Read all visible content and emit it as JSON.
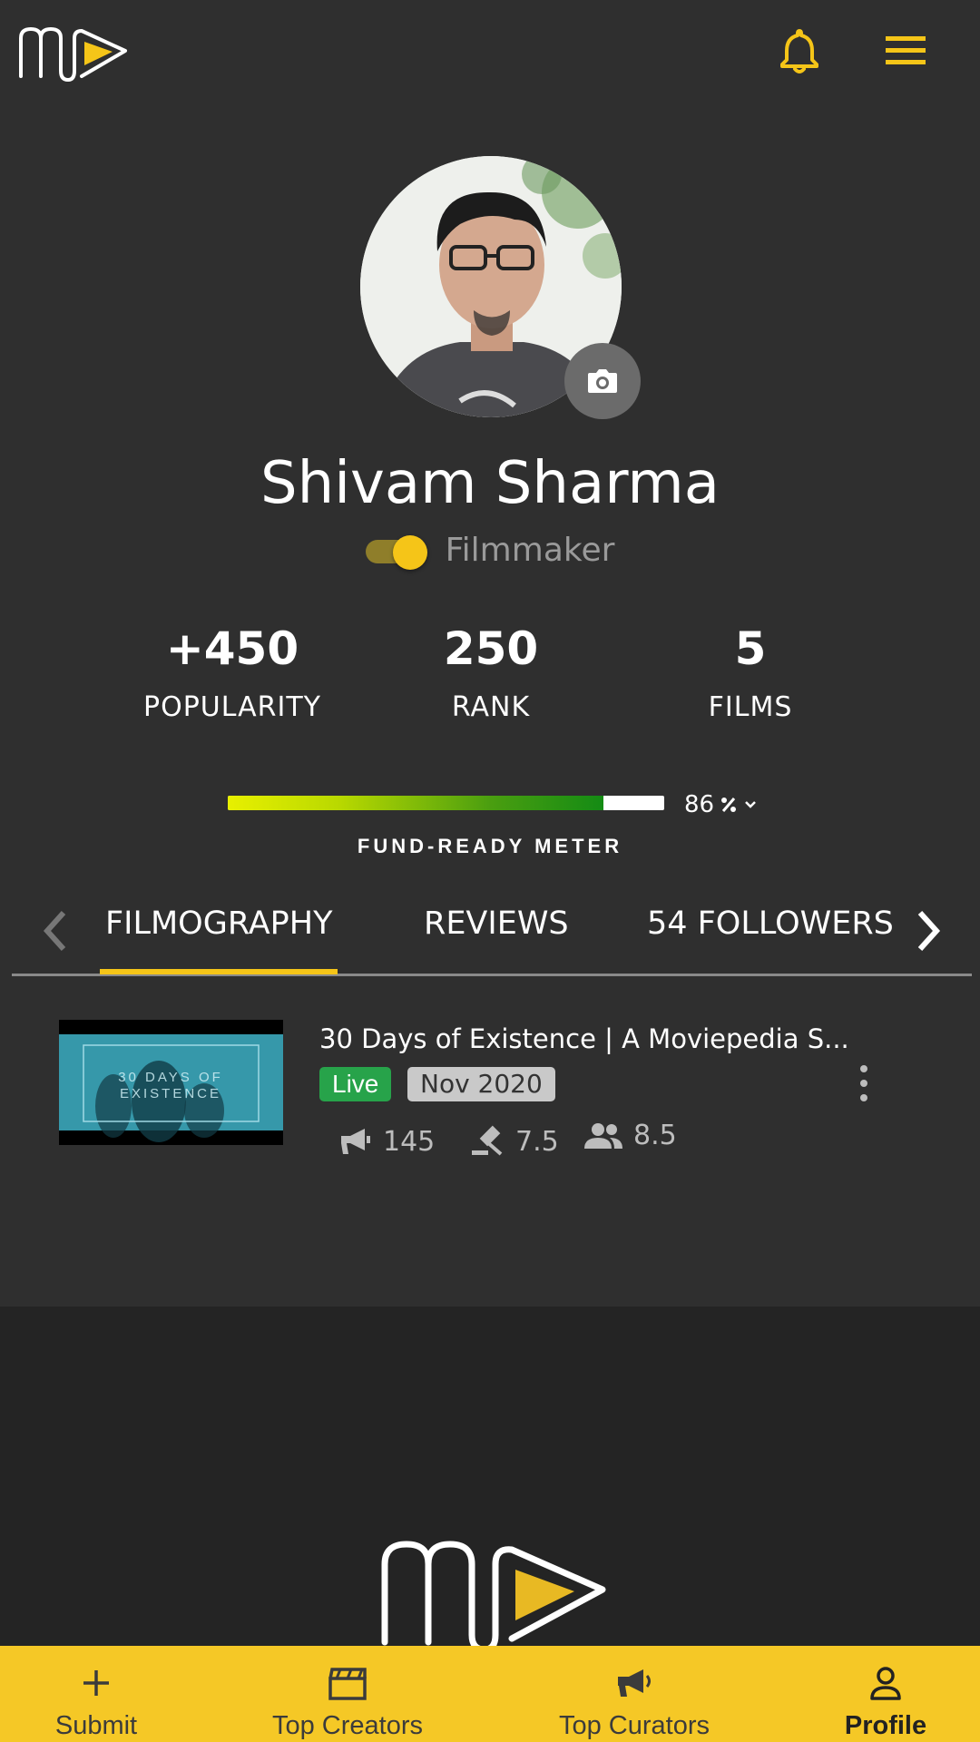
{
  "colors": {
    "accent": "#f5c518",
    "background": "#2f2f2f",
    "live": "#27a34a",
    "nav": "#f5c826"
  },
  "header": {
    "logo_icon": "moviepedia-logo",
    "notification_icon": "bell-icon",
    "menu_icon": "hamburger-menu-icon"
  },
  "profile": {
    "name": "Shivam Sharma",
    "role": "Filmmaker",
    "role_toggle_on": true,
    "camera_icon": "camera-icon"
  },
  "stats": [
    {
      "value": "+450",
      "label": "POPULARITY"
    },
    {
      "value": "250",
      "label": "RANK"
    },
    {
      "value": "5",
      "label": "FILMS"
    }
  ],
  "meter": {
    "label": "FUND-READY METER",
    "value_text": "86",
    "value_percent": 86
  },
  "tabs": [
    {
      "label": "FILMOGRAPHY",
      "active": true
    },
    {
      "label": "REVIEWS",
      "active": false
    },
    {
      "label": "54 FOLLOWERS",
      "active": false
    }
  ],
  "films": [
    {
      "title": "30 Days of Existence | A Moviepedia S...",
      "status": "Live",
      "date": "Nov 2020",
      "thumb_text_1": "30 DAYS OF",
      "thumb_text_2": "EXISTENCE",
      "metrics": [
        {
          "icon": "megaphone-icon",
          "value": "145"
        },
        {
          "icon": "gavel-icon",
          "value": "7.5"
        },
        {
          "icon": "people-icon",
          "value": "8.5"
        }
      ]
    }
  ],
  "bottom_nav": [
    {
      "label": "Submit",
      "icon": "plus-icon"
    },
    {
      "label": "Top Creators",
      "icon": "clapperboard-icon"
    },
    {
      "label": "Top Curators",
      "icon": "megaphone-icon"
    },
    {
      "label": "Profile",
      "icon": "person-icon",
      "active": true
    }
  ]
}
